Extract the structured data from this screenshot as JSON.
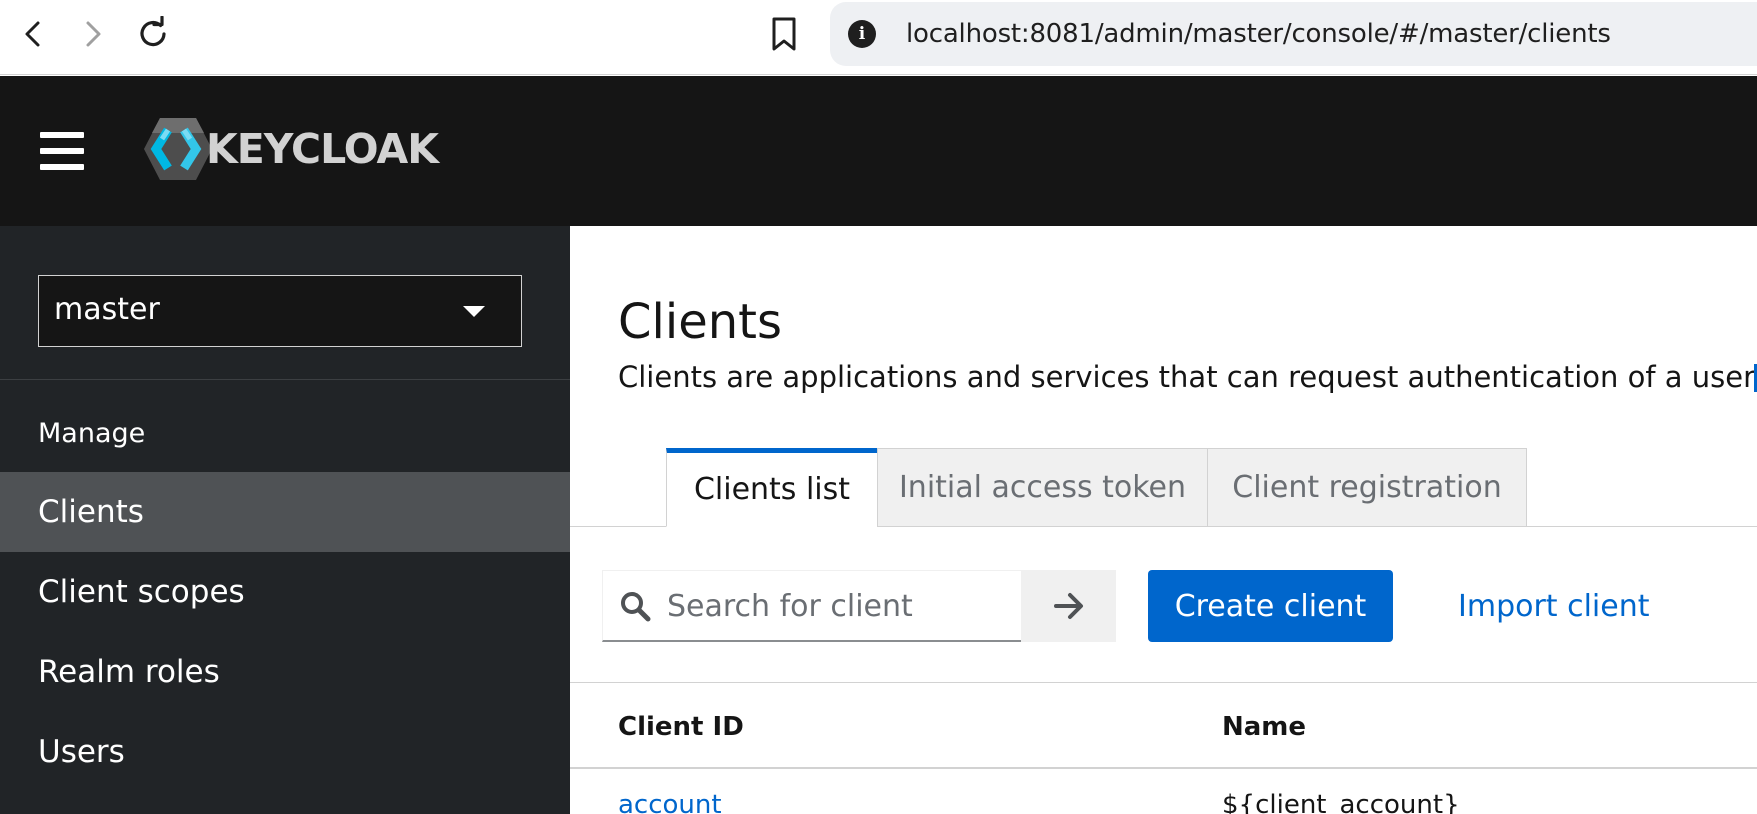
{
  "browser": {
    "url": "localhost:8081/admin/master/console/#/master/clients",
    "icons": [
      "back-arrow-icon",
      "forward-arrow-icon",
      "reload-icon",
      "bookmark-icon",
      "site-info-icon"
    ]
  },
  "masthead": {
    "logo_text": "KEYCLOAK",
    "background": "#151515"
  },
  "sidebar": {
    "realm": "master",
    "section_label": "Manage",
    "items": [
      {
        "label": "Clients",
        "active": true
      },
      {
        "label": "Client scopes",
        "active": false
      },
      {
        "label": "Realm roles",
        "active": false
      },
      {
        "label": "Users",
        "active": false
      }
    ]
  },
  "main": {
    "title": "Clients",
    "description": "Clients are applications and services that can request authentication of a user.",
    "tabs": [
      {
        "label": "Clients list",
        "active": true
      },
      {
        "label": "Initial access token",
        "active": false
      },
      {
        "label": "Client registration",
        "active": false
      }
    ],
    "toolbar": {
      "search_placeholder": "Search for client",
      "create_label": "Create client",
      "import_label": "Import client"
    },
    "table": {
      "columns": [
        "Client ID",
        "Name"
      ],
      "rows": [
        {
          "client_id": "account",
          "name": "${client_account}"
        }
      ]
    }
  },
  "colors": {
    "accent": "#0066cc",
    "sidebar_bg": "#212427",
    "sidebar_active": "#4f5255"
  }
}
